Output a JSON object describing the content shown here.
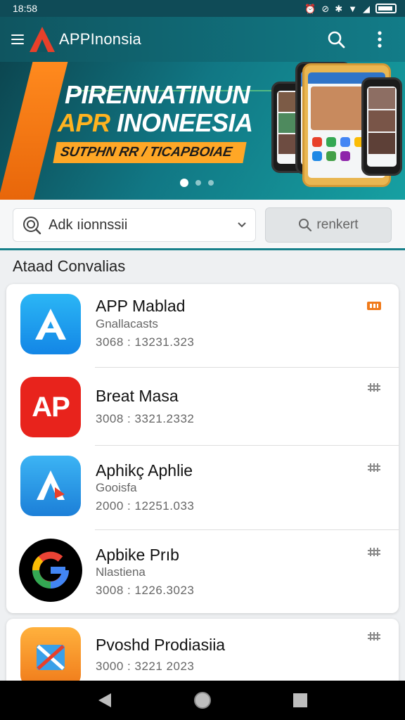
{
  "status_bar": {
    "time": "18:58"
  },
  "app_bar": {
    "title": "APPInonsia"
  },
  "banner": {
    "headline_1": "PIRENNATINUN",
    "headline_2_highlight": "APR",
    "headline_2_rest": " INONEESIA",
    "subtitle": "SUTPHN RR / TICAPBOIAE",
    "pages": 3,
    "active_page": 1
  },
  "filter": {
    "dropdown_value": "Adk ıionnssii",
    "search_label": "renkert"
  },
  "section_title": "Ataad Convalias",
  "apps": [
    {
      "name": "APP Mablad",
      "sub": "Gnallacasts",
      "date": "3068 : 13231.323"
    },
    {
      "name": "Breat Masa",
      "sub": "",
      "date": "3008 : 3321.2332"
    },
    {
      "name": "Aphikç Aphlie",
      "sub": "Gooisfa",
      "date": "2000 : 12251.033"
    },
    {
      "name": "Apbike Prıb",
      "sub": "Nlastiena",
      "date": "3008 : 1226.3023"
    },
    {
      "name": "Pvoshd Prodiasiia",
      "sub": "",
      "date": "3000 : 3221 2023"
    }
  ],
  "colors": {
    "primary": "#127c88",
    "accent": "#ff8a1e",
    "badge_orange": "#f07a1a"
  }
}
